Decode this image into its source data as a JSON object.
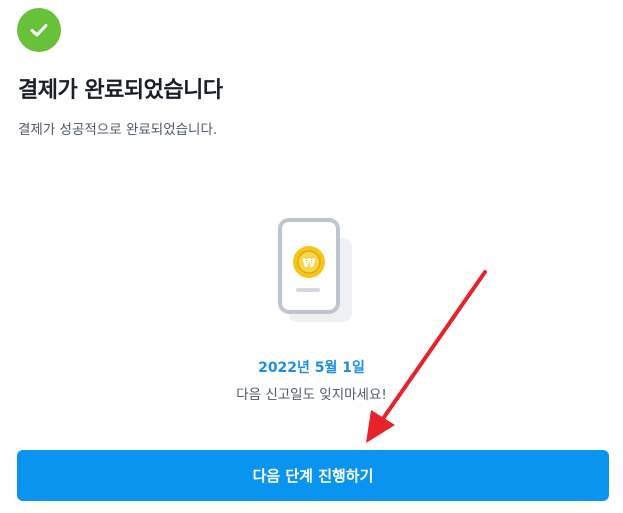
{
  "header": {
    "title": "결제가 완료되었습니다",
    "subtitle": "결제가 성공적으로 완료되었습니다.",
    "status_icon": "check-icon"
  },
  "notice": {
    "illustration_icon": "phone-coin-icon",
    "coin_symbol": "₩",
    "date": "2022년 5월 1일",
    "message": "다음 신고일도 잊지마세요!"
  },
  "actions": {
    "next_label": "다음 단계 진행하기"
  },
  "colors": {
    "success": "#67c23a",
    "accent": "#0994f0",
    "date_text": "#1a8fe3",
    "coin": "#f5c518",
    "annotation": "#e8222b"
  }
}
